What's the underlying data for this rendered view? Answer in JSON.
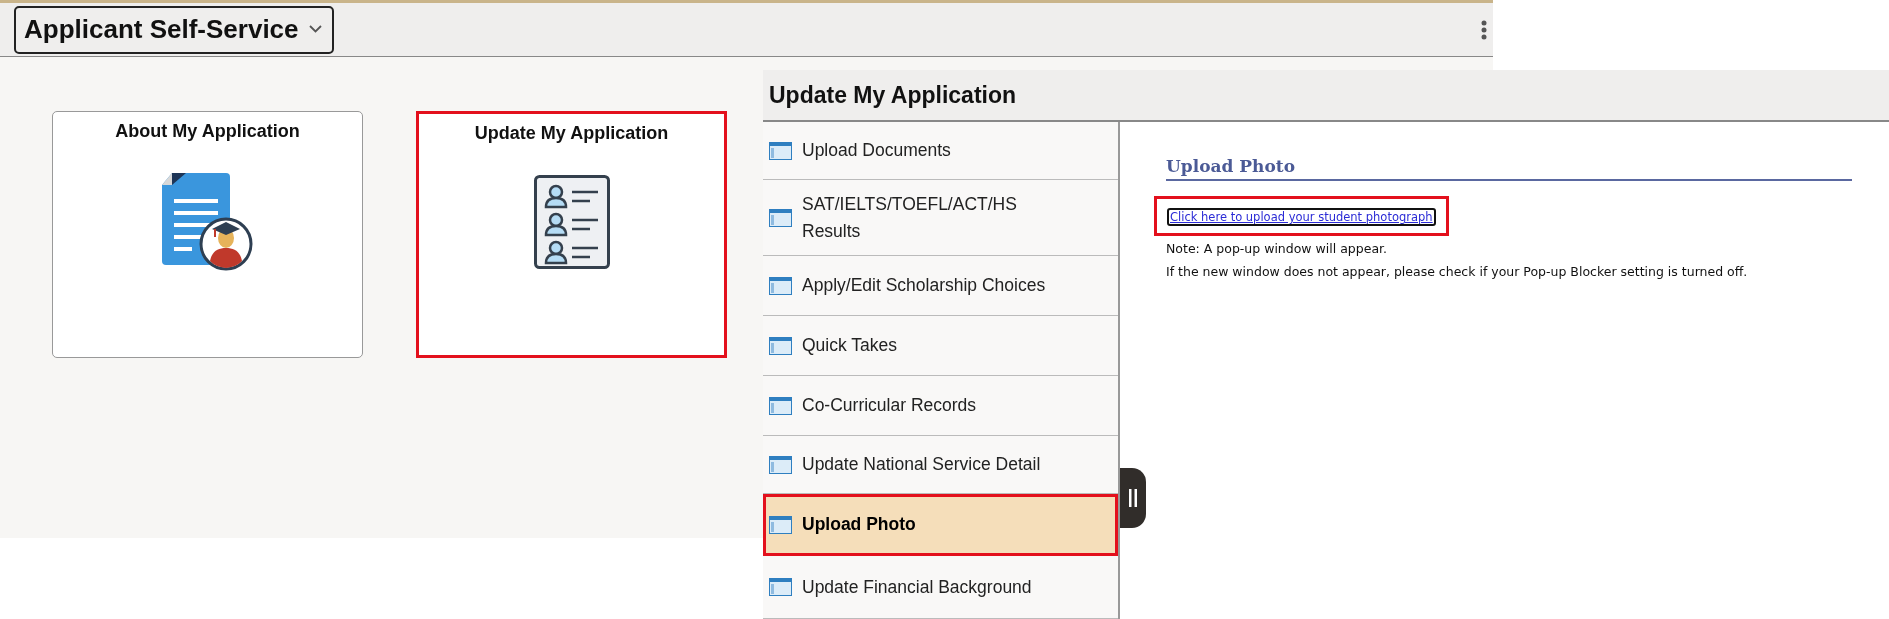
{
  "header": {
    "title": "Applicant Self-Service"
  },
  "tiles": [
    {
      "title": "About My Application",
      "kind": "document",
      "highlighted": false
    },
    {
      "title": "Update My Application",
      "kind": "roster",
      "highlighted": true
    }
  ],
  "panel": {
    "title": "Update My Application",
    "nav_items": [
      {
        "label": "Upload Documents",
        "selected": false,
        "highlighted": false
      },
      {
        "label": "SAT/IELTS/TOEFL/ACT/HS Results",
        "selected": false,
        "highlighted": false
      },
      {
        "label": "Apply/Edit Scholarship Choices",
        "selected": false,
        "highlighted": false
      },
      {
        "label": "Quick Takes",
        "selected": false,
        "highlighted": false
      },
      {
        "label": "Co-Curricular Records",
        "selected": false,
        "highlighted": false
      },
      {
        "label": "Update National Service Detail",
        "selected": false,
        "highlighted": false
      },
      {
        "label": "Upload Photo",
        "selected": true,
        "highlighted": true
      },
      {
        "label": "Update Financial Background",
        "selected": false,
        "highlighted": false
      }
    ],
    "content": {
      "heading": "Upload Photo",
      "link": {
        "text": "Click here to upload your student photograph",
        "highlighted": true
      },
      "notes": [
        "Note: A pop-up window will appear.",
        "If the new window does not appear, please check if your Pop-up Blocker setting is turned off."
      ]
    }
  }
}
